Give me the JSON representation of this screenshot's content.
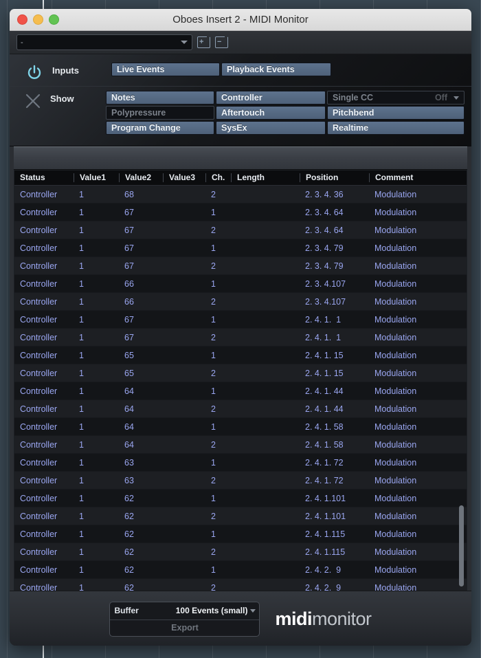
{
  "window": {
    "title": "Oboes Insert 2 - MIDI Monitor",
    "traffic_lights": [
      "close-button",
      "minimize-button",
      "maximize-button"
    ]
  },
  "preset_bar": {
    "preset_value": "-",
    "add_preset_icon": "document-add-icon",
    "remove_preset_icon": "document-remove-icon",
    "add_sign": "+",
    "remove_sign": "−"
  },
  "controls": {
    "inputs": {
      "icon": "power-icon",
      "label": "Inputs",
      "buttons": [
        {
          "label": "Live Events",
          "state": "on"
        },
        {
          "label": "Playback Events",
          "state": "on"
        }
      ]
    },
    "show": {
      "icon": "clear-x-icon",
      "label": "Show",
      "rows": [
        [
          {
            "label": "Notes",
            "state": "on"
          },
          {
            "label": "Controller",
            "state": "on"
          },
          {
            "label": "Single CC",
            "state": "off",
            "value": "Off",
            "is_select": true
          }
        ],
        [
          {
            "label": "Polypressure",
            "state": "off"
          },
          {
            "label": "Aftertouch",
            "state": "on"
          },
          {
            "label": "Pitchbend",
            "state": "on"
          }
        ],
        [
          {
            "label": "Program Change",
            "state": "on"
          },
          {
            "label": "SysEx",
            "state": "on"
          },
          {
            "label": "Realtime",
            "state": "on"
          }
        ]
      ]
    }
  },
  "table": {
    "columns": [
      "Status",
      "Value1",
      "Value2",
      "Value3",
      "Ch.",
      "Length",
      "Position",
      "Comment"
    ],
    "rows": [
      {
        "status": "Controller",
        "value1": "1",
        "value2": "68",
        "value3": "",
        "ch": "2",
        "length": "",
        "position": "2. 3. 4. 36",
        "comment": "Modulation"
      },
      {
        "status": "Controller",
        "value1": "1",
        "value2": "67",
        "value3": "",
        "ch": "1",
        "length": "",
        "position": "2. 3. 4. 64",
        "comment": "Modulation"
      },
      {
        "status": "Controller",
        "value1": "1",
        "value2": "67",
        "value3": "",
        "ch": "2",
        "length": "",
        "position": "2. 3. 4. 64",
        "comment": "Modulation"
      },
      {
        "status": "Controller",
        "value1": "1",
        "value2": "67",
        "value3": "",
        "ch": "1",
        "length": "",
        "position": "2. 3. 4. 79",
        "comment": "Modulation"
      },
      {
        "status": "Controller",
        "value1": "1",
        "value2": "67",
        "value3": "",
        "ch": "2",
        "length": "",
        "position": "2. 3. 4. 79",
        "comment": "Modulation"
      },
      {
        "status": "Controller",
        "value1": "1",
        "value2": "66",
        "value3": "",
        "ch": "1",
        "length": "",
        "position": "2. 3. 4.107",
        "comment": "Modulation"
      },
      {
        "status": "Controller",
        "value1": "1",
        "value2": "66",
        "value3": "",
        "ch": "2",
        "length": "",
        "position": "2. 3. 4.107",
        "comment": "Modulation"
      },
      {
        "status": "Controller",
        "value1": "1",
        "value2": "67",
        "value3": "",
        "ch": "1",
        "length": "",
        "position": "2. 4. 1.  1",
        "comment": "Modulation"
      },
      {
        "status": "Controller",
        "value1": "1",
        "value2": "67",
        "value3": "",
        "ch": "2",
        "length": "",
        "position": "2. 4. 1.  1",
        "comment": "Modulation"
      },
      {
        "status": "Controller",
        "value1": "1",
        "value2": "65",
        "value3": "",
        "ch": "1",
        "length": "",
        "position": "2. 4. 1. 15",
        "comment": "Modulation"
      },
      {
        "status": "Controller",
        "value1": "1",
        "value2": "65",
        "value3": "",
        "ch": "2",
        "length": "",
        "position": "2. 4. 1. 15",
        "comment": "Modulation"
      },
      {
        "status": "Controller",
        "value1": "1",
        "value2": "64",
        "value3": "",
        "ch": "1",
        "length": "",
        "position": "2. 4. 1. 44",
        "comment": "Modulation"
      },
      {
        "status": "Controller",
        "value1": "1",
        "value2": "64",
        "value3": "",
        "ch": "2",
        "length": "",
        "position": "2. 4. 1. 44",
        "comment": "Modulation"
      },
      {
        "status": "Controller",
        "value1": "1",
        "value2": "64",
        "value3": "",
        "ch": "1",
        "length": "",
        "position": "2. 4. 1. 58",
        "comment": "Modulation"
      },
      {
        "status": "Controller",
        "value1": "1",
        "value2": "64",
        "value3": "",
        "ch": "2",
        "length": "",
        "position": "2. 4. 1. 58",
        "comment": "Modulation"
      },
      {
        "status": "Controller",
        "value1": "1",
        "value2": "63",
        "value3": "",
        "ch": "1",
        "length": "",
        "position": "2. 4. 1. 72",
        "comment": "Modulation"
      },
      {
        "status": "Controller",
        "value1": "1",
        "value2": "63",
        "value3": "",
        "ch": "2",
        "length": "",
        "position": "2. 4. 1. 72",
        "comment": "Modulation"
      },
      {
        "status": "Controller",
        "value1": "1",
        "value2": "62",
        "value3": "",
        "ch": "1",
        "length": "",
        "position": "2. 4. 1.101",
        "comment": "Modulation"
      },
      {
        "status": "Controller",
        "value1": "1",
        "value2": "62",
        "value3": "",
        "ch": "2",
        "length": "",
        "position": "2. 4. 1.101",
        "comment": "Modulation"
      },
      {
        "status": "Controller",
        "value1": "1",
        "value2": "62",
        "value3": "",
        "ch": "1",
        "length": "",
        "position": "2. 4. 1.115",
        "comment": "Modulation"
      },
      {
        "status": "Controller",
        "value1": "1",
        "value2": "62",
        "value3": "",
        "ch": "2",
        "length": "",
        "position": "2. 4. 1.115",
        "comment": "Modulation"
      },
      {
        "status": "Controller",
        "value1": "1",
        "value2": "62",
        "value3": "",
        "ch": "1",
        "length": "",
        "position": "2. 4. 2.  9",
        "comment": "Modulation"
      },
      {
        "status": "Controller",
        "value1": "1",
        "value2": "62",
        "value3": "",
        "ch": "2",
        "length": "",
        "position": "2. 4. 2.  9",
        "comment": "Modulation"
      }
    ]
  },
  "footer": {
    "buffer_label": "Buffer",
    "buffer_value": "100 Events (small)",
    "export_label": "Export",
    "logo_bold": "midi",
    "logo_light": "monitor"
  },
  "colors": {
    "accent_blue": "#5d728d",
    "row_text": "#9aa6f0",
    "power_icon": "#7fd4e8",
    "panel_bg": "#0d0e10",
    "desktop": "#3a4853"
  }
}
